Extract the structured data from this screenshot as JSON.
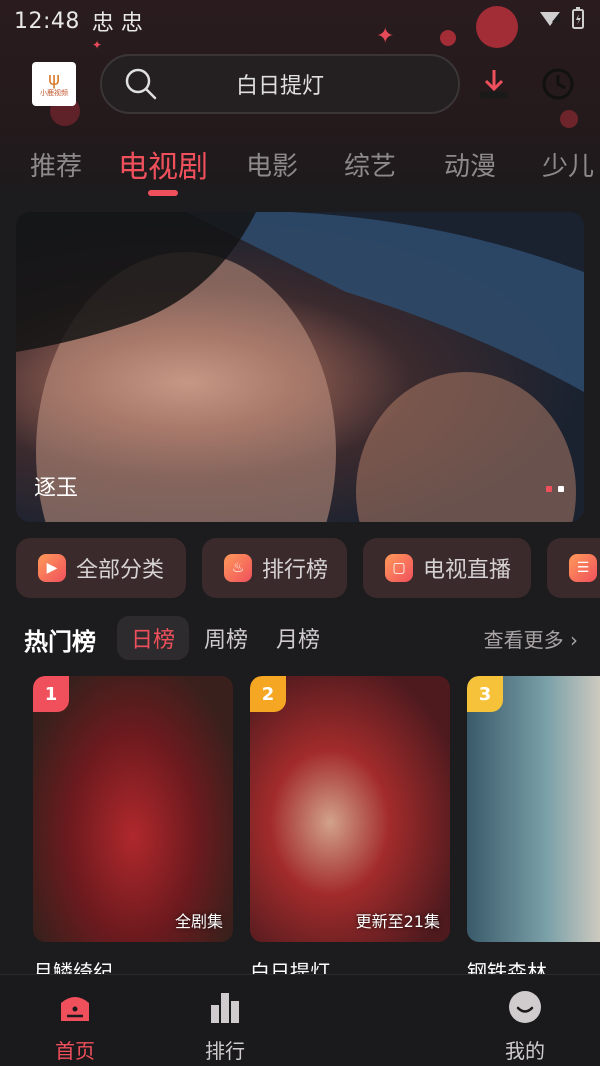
{
  "status_bar": {
    "time": "12:48",
    "notifications": "忠 忠"
  },
  "header": {
    "logo_text": "小鹿视频",
    "search_placeholder": "白日提灯",
    "icons": [
      "search-icon",
      "download-icon",
      "history-icon"
    ]
  },
  "tabs": [
    {
      "label": "推荐",
      "active": false
    },
    {
      "label": "电视剧",
      "active": true
    },
    {
      "label": "电影",
      "active": false
    },
    {
      "label": "综艺",
      "active": false
    },
    {
      "label": "动漫",
      "active": false
    },
    {
      "label": "少儿",
      "active": false
    }
  ],
  "banner": {
    "title": "逐玉",
    "page_count": 2,
    "active_page": 1
  },
  "quick_links": [
    {
      "label": "全部分类",
      "icon": "play-icon"
    },
    {
      "label": "排行榜",
      "icon": "fire-icon"
    },
    {
      "label": "电视直播",
      "icon": "tv-icon"
    },
    {
      "label": "",
      "icon": "schedule-icon"
    }
  ],
  "hot": {
    "title": "热门榜",
    "tabs": [
      {
        "label": "日榜",
        "active": true
      },
      {
        "label": "周榜",
        "active": false
      },
      {
        "label": "月榜",
        "active": false
      }
    ],
    "more_label": "查看更多 ›",
    "items": [
      {
        "rank": "1",
        "name": "月鳞绮纪",
        "tag": "全剧集",
        "rank_color": "#f0505c"
      },
      {
        "rank": "2",
        "name": "白日提灯",
        "tag": "更新至21集",
        "rank_color": "#f5a623"
      },
      {
        "rank": "3",
        "name": "钢铁森林",
        "tag": "",
        "rank_color": "#f5c23a"
      }
    ]
  },
  "bottom_nav": [
    {
      "label": "首页",
      "icon": "home-icon",
      "active": true
    },
    {
      "label": "排行",
      "icon": "ranking-icon",
      "active": false
    },
    {
      "label": "我的",
      "icon": "profile-icon",
      "active": false
    }
  ],
  "colors": {
    "accent": "#f0505c",
    "background": "#1c1b1d"
  }
}
